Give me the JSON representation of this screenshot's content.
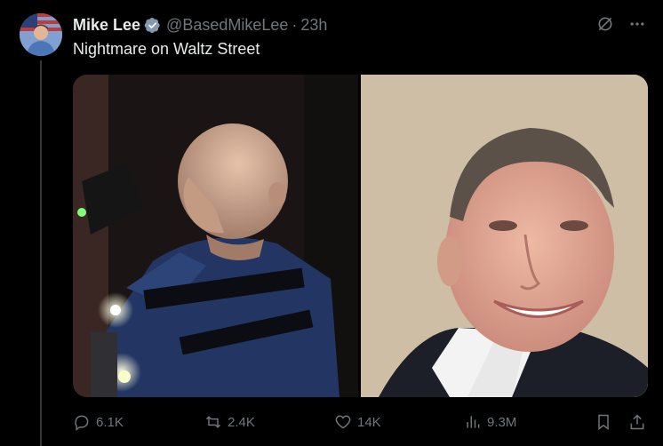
{
  "tweet": {
    "author_name": "Mike Lee",
    "handle": "@BasedMikeLee",
    "separator": "·",
    "time": "23h",
    "text": "Nightmare on Waltz Street",
    "verified": true
  },
  "icons": {
    "verified": "verified-badge-icon",
    "grok": "grok-icon",
    "more": "more-horizontal-icon",
    "reply": "reply-icon",
    "retweet": "retweet-icon",
    "like": "heart-icon",
    "views": "analytics-icon",
    "bookmark": "bookmark-icon",
    "share": "share-icon"
  },
  "actions": {
    "replies": "6.1K",
    "reposts": "2.4K",
    "likes": "14K",
    "views": "9.3M"
  },
  "colors": {
    "background": "#000000",
    "text": "#e7e9ea",
    "muted": "#71767b",
    "verified": "#829aab"
  }
}
